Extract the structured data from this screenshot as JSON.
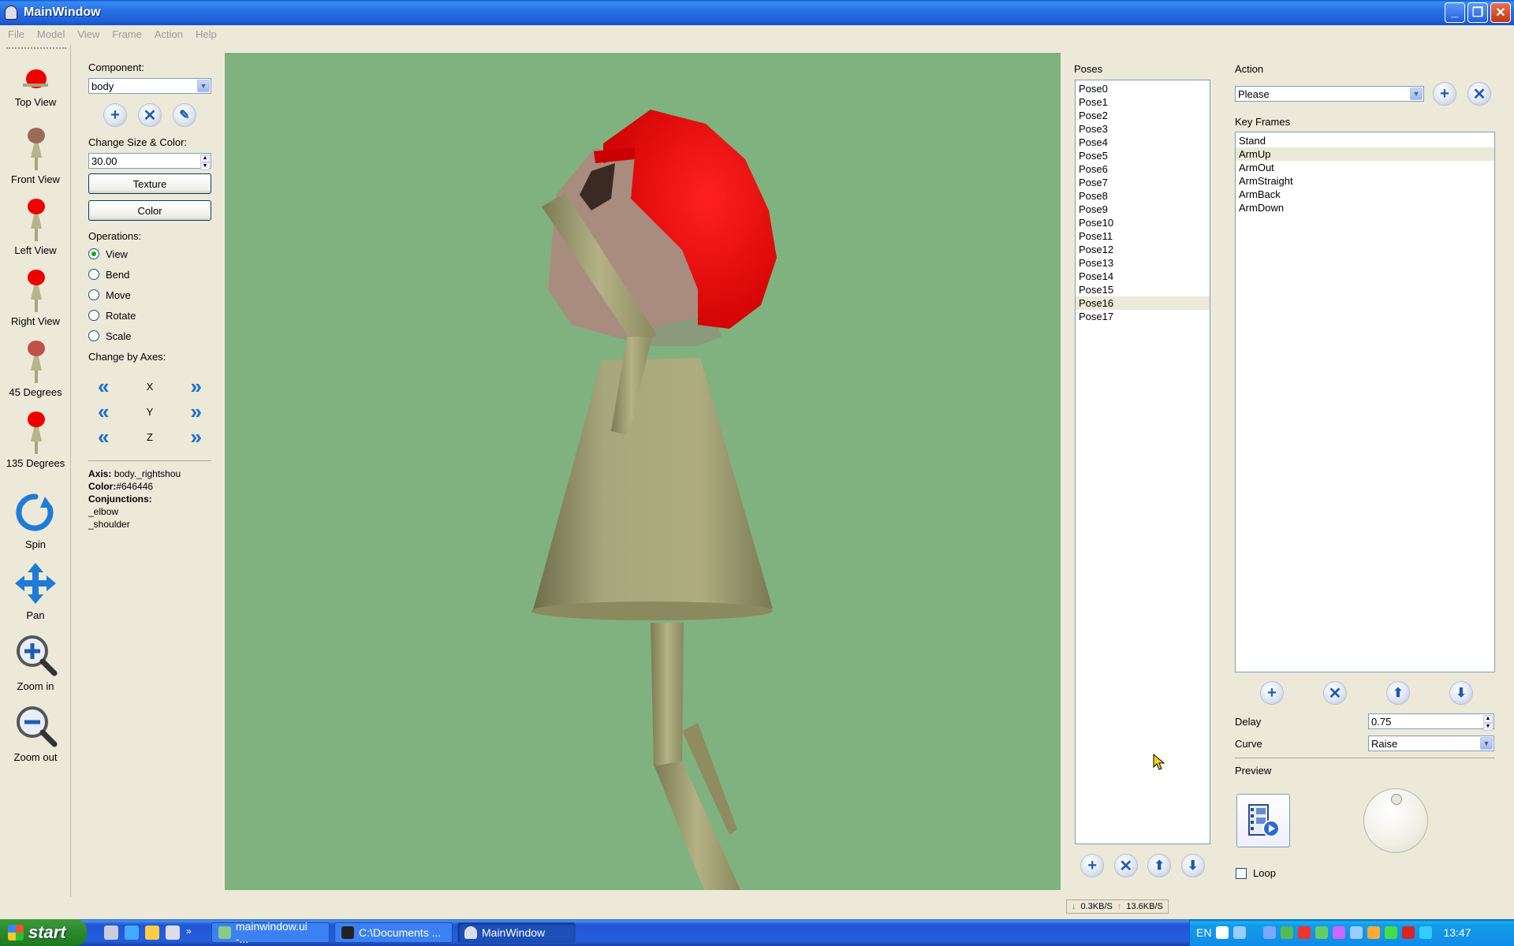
{
  "window": {
    "title": "MainWindow"
  },
  "menu": [
    "File",
    "Model",
    "View",
    "Frame",
    "Action",
    "Help"
  ],
  "toolstrip": [
    {
      "label": "Top View"
    },
    {
      "label": "Front View"
    },
    {
      "label": "Left View"
    },
    {
      "label": "Right View"
    },
    {
      "label": "45 Degrees"
    },
    {
      "label": "135 Degrees"
    },
    {
      "label": "Spin"
    },
    {
      "label": "Pan"
    },
    {
      "label": "Zoom in"
    },
    {
      "label": "Zoom out"
    }
  ],
  "component": {
    "label": "Component:",
    "value": "body",
    "size_color_label": "Change Size & Color:",
    "size_value": "30.00",
    "texture_button": "Texture",
    "color_button": "Color",
    "operations_label": "Operations:",
    "operations": [
      "View",
      "Bend",
      "Move",
      "Rotate",
      "Scale"
    ],
    "selected_operation": "View",
    "axes_label": "Change by Axes:",
    "axes": [
      "X",
      "Y",
      "Z"
    ]
  },
  "info": {
    "axis_key": "Axis:",
    "axis_value": "body._rightshou",
    "color_key": "Color:",
    "color_value": "#646446",
    "conj_key": "Conjunctions:",
    "conjunctions": [
      "_elbow",
      "_shoulder"
    ]
  },
  "poses": {
    "label": "Poses",
    "items": [
      "Pose0",
      "Pose1",
      "Pose2",
      "Pose3",
      "Pose4",
      "Pose5",
      "Pose6",
      "Pose7",
      "Pose8",
      "Pose9",
      "Pose10",
      "Pose11",
      "Pose12",
      "Pose13",
      "Pose14",
      "Pose15",
      "Pose16",
      "Pose17"
    ],
    "selected": "Pose16"
  },
  "action": {
    "label": "Action",
    "value": "Please",
    "keyframes_label": "Key Frames",
    "keyframes": [
      "Stand",
      "ArmUp",
      "ArmOut",
      "ArmStraight",
      "ArmBack",
      "ArmDown"
    ],
    "selected_keyframe": "ArmUp",
    "delay_label": "Delay",
    "delay_value": "0.75",
    "curve_label": "Curve",
    "curve_value": "Raise",
    "preview_label": "Preview",
    "loop_label": "Loop"
  },
  "netstat": {
    "down": "0.3KB/S",
    "up": "13.6KB/S"
  },
  "taskbar": {
    "start": "start",
    "tasks": [
      "mainwindow.ui -...",
      "C:\\Documents ...",
      "MainWindow"
    ],
    "lang": "EN",
    "clock": "13:47"
  },
  "colors": {
    "viewport_bg": "#7fb27f",
    "head": "#ee0000",
    "skin": "#a88c7d",
    "body": "#a8a67c"
  }
}
